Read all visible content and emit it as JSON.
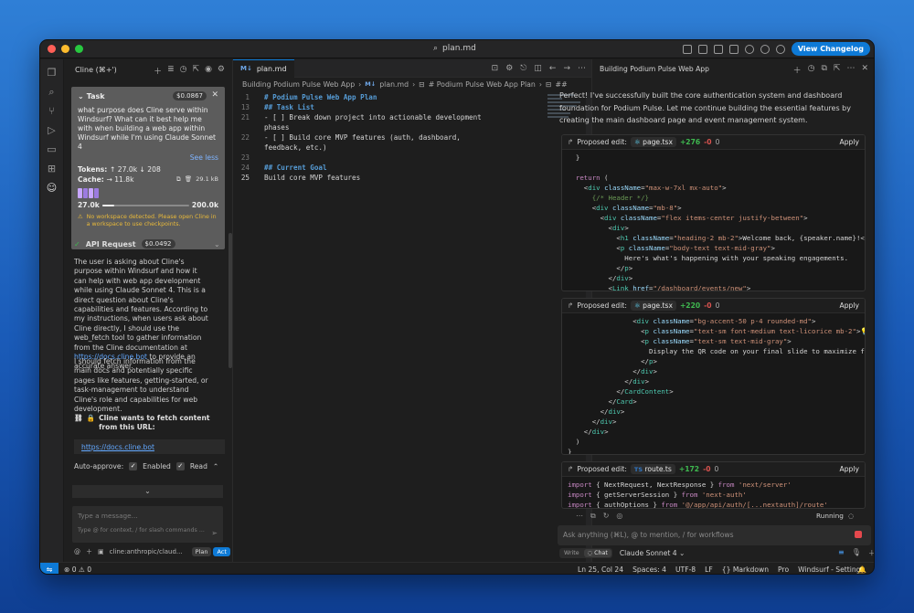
{
  "titlebar": {
    "search": "plan.md",
    "changelog_btn": "View Changelog"
  },
  "cline": {
    "header": "Cline (⌘+')",
    "task": {
      "title": "Task",
      "price": "$0.0867",
      "text": "what purpose does Cline serve within Windsurf? What can it best help me with when building a web app within Windsurf while I'm using Claude Sonnet 4",
      "see_less": "See less",
      "tokens_label": "Tokens:",
      "tokens_value": "↑ 27.0k ↓ 208",
      "cache_label": "Cache:",
      "cache_value": "→ 11.8k",
      "cache_size": "29.1 kB",
      "context_used": "27.0k",
      "context_max": "200.0k",
      "context_fraction": 0.135,
      "warning": "No workspace detected. Please open Cline in a workspace to use checkpoints."
    },
    "api_request": {
      "label": "API Request",
      "price": "$0.0492"
    },
    "para1_pre": "The user is asking about Cline's purpose within Windsurf and how it can help with web app development while using Claude Sonnet 4. This is a direct question about Cline's capabilities and features. According to my instructions, when users ask about Cline directly, I should use the web_fetch tool to gather information from the Cline documentation at ",
    "para1_link": "https://docs.cline.bot",
    "para1_post": " to provide an accurate answer.",
    "para2": "I should fetch information from the main docs and potentially specific pages like features, getting-started, or task-management to understand Cline's role and capabilities for web development.",
    "fetch_label": "Cline wants to fetch content from this URL:",
    "fetch_url": "https://docs.cline.bot",
    "auto_approve": "Auto-approve:",
    "enabled": "Enabled",
    "read": "Read",
    "msg_placeholder": "Type a message...",
    "msg_hint": "Type @ for context, / for slash commands ...",
    "model": "cline:anthropic/claud...",
    "plan": "Plan",
    "act": "Act"
  },
  "editor": {
    "tab": "plan.md",
    "breadcrumb": [
      "Building Podium Pulse Web App",
      "plan.md",
      "# Podium Pulse Web App Plan",
      "##"
    ],
    "lines": [
      {
        "n": "1",
        "t": "# Podium Pulse Web App Plan",
        "h": true
      },
      {
        "n": "13",
        "t": "## Task List",
        "h": true
      },
      {
        "n": "21",
        "t": "- [ ] Break down project into actionable development",
        "h": false
      },
      {
        "n": "",
        "t": "phases",
        "h": false
      },
      {
        "n": "22",
        "t": "- [ ] Build core MVP features (auth, dashboard,",
        "h": false
      },
      {
        "n": "",
        "t": "feedback, etc.)",
        "h": false
      },
      {
        "n": "23",
        "t": "",
        "h": false
      },
      {
        "n": "24",
        "t": "## Current Goal",
        "h": true
      },
      {
        "n": "25",
        "t": "Build core MVP features",
        "h": false,
        "cur": true
      }
    ]
  },
  "panel": {
    "header": "Building Podium Pulse Web App",
    "intro": "Perfect! I've successfully built the core authentication system and dashboard foundation for Podium Pulse. Let me continue building the essential features by creating the main dashboard page and event management system.",
    "proposed": "Proposed edit:",
    "apply": "Apply",
    "edit1": {
      "file": "page.tsx",
      "add": "+276",
      "rem": "-0",
      "zero": "0"
    },
    "edit2": {
      "file": "page.tsx",
      "add": "+220",
      "rem": "-0",
      "zero": "0"
    },
    "edit3": {
      "file": "route.ts",
      "add": "+172",
      "rem": "-0",
      "zero": "0"
    },
    "running": "Running",
    "ask_placeholder": "Ask anything (⌘L), @ to mention, / for workflows",
    "write": "Write",
    "chat": "Chat",
    "model": "Claude Sonnet 4"
  },
  "status": {
    "problems": "⊗ 0 ⚠ 0",
    "pos": "Ln 25, Col 24",
    "spaces": "Spaces: 4",
    "enc": "UTF-8",
    "eol": "LF",
    "lang": "{} Markdown",
    "pro": "Pro",
    "settings": "Windsurf - Settings"
  }
}
